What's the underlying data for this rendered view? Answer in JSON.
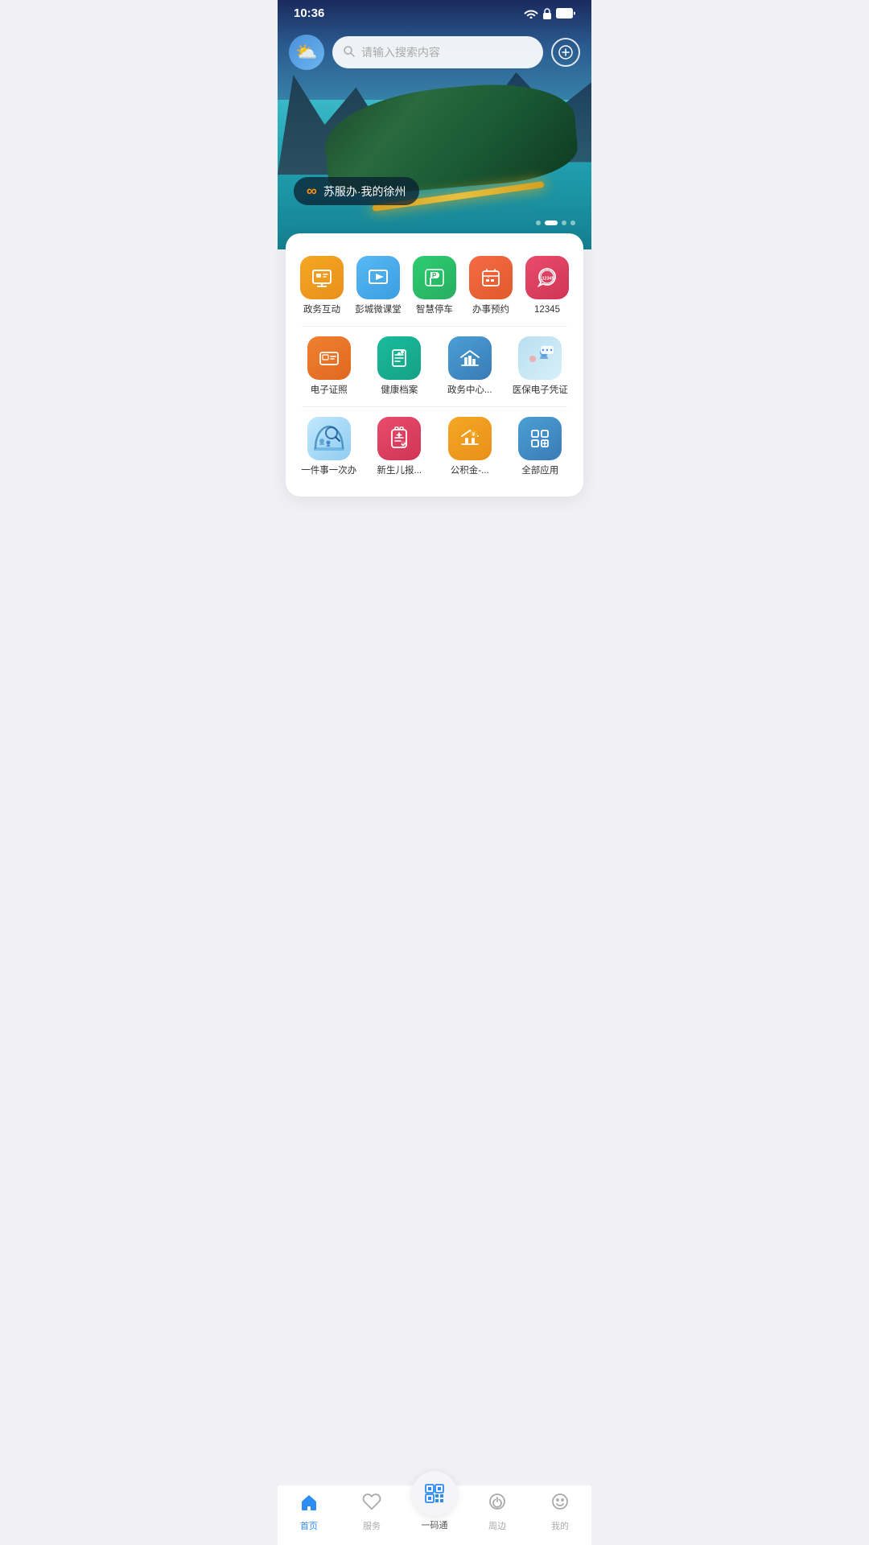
{
  "statusBar": {
    "time": "10:36"
  },
  "header": {
    "searchPlaceholder": "请输入搜索内容",
    "addLabel": "+",
    "weatherEmoji": "⛅"
  },
  "banner": {
    "label": "苏服办·我的徐州",
    "logoText": "∞",
    "dots": [
      false,
      true,
      false,
      false
    ]
  },
  "appGrid": {
    "row1": [
      {
        "id": "gov-interact",
        "name": "政务互动",
        "icon": "monitor",
        "color": "orange"
      },
      {
        "id": "pengcheng-course",
        "name": "彭城微课堂",
        "icon": "play",
        "color": "blue-light"
      },
      {
        "id": "smart-parking",
        "name": "智慧停车",
        "icon": "parking",
        "color": "green"
      },
      {
        "id": "appt",
        "name": "办事预约",
        "icon": "calendar",
        "color": "red-orange"
      },
      {
        "id": "12345",
        "name": "12345",
        "icon": "phone",
        "color": "pink-red"
      }
    ],
    "row2": [
      {
        "id": "e-license",
        "name": "电子证照",
        "icon": "id-card",
        "color": "orange2"
      },
      {
        "id": "health-record",
        "name": "健康档案",
        "icon": "heart-doc",
        "color": "teal"
      },
      {
        "id": "gov-center",
        "name": "政务中心...",
        "icon": "bank",
        "color": "blue2"
      },
      {
        "id": "medical-ins",
        "name": "医保电子凭证",
        "icon": "medical",
        "color": "medical"
      }
    ],
    "row3": [
      {
        "id": "one-thing",
        "name": "一件事一次办",
        "icon": "yijian",
        "color": "yijian"
      },
      {
        "id": "newborn",
        "name": "新生儿报...",
        "icon": "clipboard",
        "color": "pink-red"
      },
      {
        "id": "fund",
        "name": "公积金-...",
        "icon": "house-money",
        "color": "orange"
      },
      {
        "id": "all-apps",
        "name": "全部应用",
        "icon": "grid",
        "color": "blue2"
      }
    ]
  },
  "bottomNav": {
    "items": [
      {
        "id": "home",
        "label": "首页",
        "icon": "home",
        "active": true
      },
      {
        "id": "service",
        "label": "服务",
        "icon": "heart",
        "active": false
      },
      {
        "id": "yimatong",
        "label": "一码通",
        "icon": "qr",
        "active": false,
        "center": true
      },
      {
        "id": "nearby",
        "label": "周边",
        "icon": "power",
        "active": false
      },
      {
        "id": "mine",
        "label": "我的",
        "icon": "face",
        "active": false
      }
    ]
  }
}
